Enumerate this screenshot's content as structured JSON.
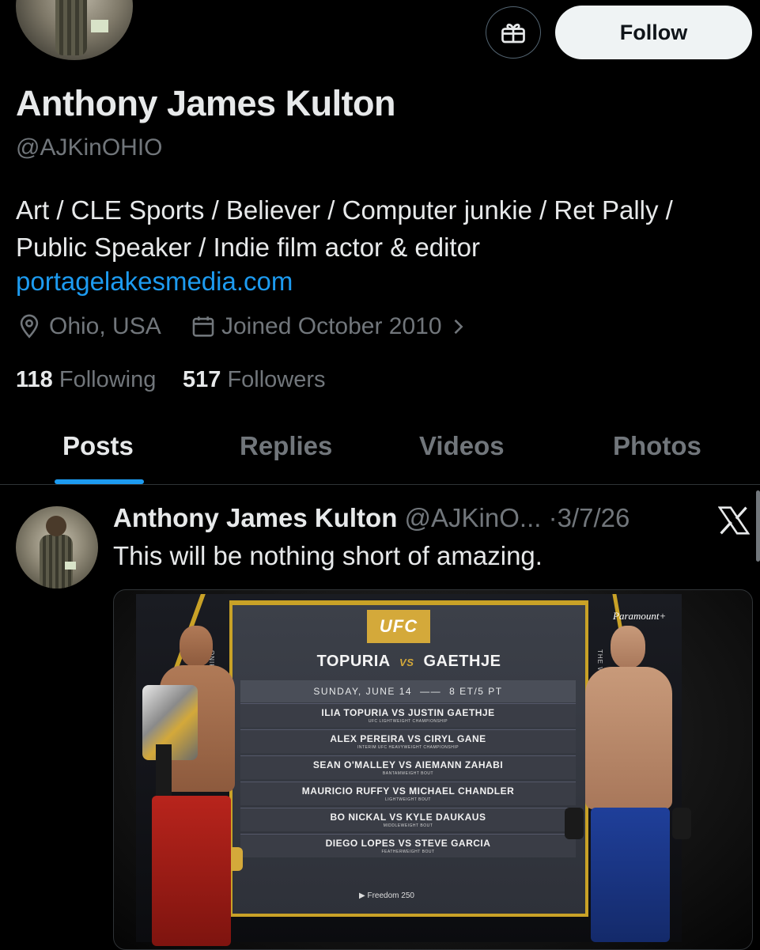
{
  "profile": {
    "name": "Anthony James Kulton",
    "handle": "@AJKinOHIO",
    "bio_line1": "Art / CLE Sports / Believer / Computer junkie / Ret Pally /",
    "bio_line2": "Public Speaker / Indie film actor & editor",
    "website": "portagelakesmedia.com",
    "location": "Ohio, USA",
    "joined": "Joined October 2010",
    "following_count": "118",
    "following_label": "Following",
    "followers_count": "517",
    "followers_label": "Followers",
    "follow_button": "Follow",
    "icons": [
      "gift-icon",
      "location-pin-icon",
      "calendar-icon",
      "chevron-right-icon"
    ]
  },
  "tabs": [
    {
      "label": "Posts",
      "active": true
    },
    {
      "label": "Replies",
      "active": false
    },
    {
      "label": "Videos",
      "active": false
    },
    {
      "label": "Photos",
      "active": false
    }
  ],
  "post": {
    "author": "Anthony James Kulton",
    "handle": "@AJKinO...",
    "separator": "·",
    "date": "3/7/26",
    "text": "This will be nothing short of amazing.",
    "source_icon": "x-logo-icon",
    "media": {
      "brand": "UFC",
      "title_left": "TOPURIA",
      "vs": "VS",
      "title_right": "GAETHJE",
      "date": "SUNDAY, JUNE 14",
      "time": "8 ET/5 PT",
      "side_left": "WASHING",
      "side_right": "THE WHITE HOUSE",
      "network": "Paramount+",
      "footer": "▶ Freedom 250",
      "bouts": [
        {
          "fighters": "ILIA TOPURIA VS JUSTIN GAETHJE",
          "division": "UFC LIGHTWEIGHT CHAMPIONSHIP"
        },
        {
          "fighters": "ALEX PEREIRA VS CIRYL GANE",
          "division": "INTERIM UFC HEAVYWEIGHT CHAMPIONSHIP"
        },
        {
          "fighters": "SEAN O'MALLEY VS AIEMANN ZAHABI",
          "division": "BANTAMWEIGHT BOUT"
        },
        {
          "fighters": "MAURICIO RUFFY VS MICHAEL CHANDLER",
          "division": "LIGHTWEIGHT BOUT"
        },
        {
          "fighters": "BO NICKAL VS KYLE DAUKAUS",
          "division": "MIDDLEWEIGHT BOUT"
        },
        {
          "fighters": "DIEGO LOPES VS STEVE GARCIA",
          "division": "FEATHERWEIGHT BOUT"
        }
      ]
    }
  },
  "colors": {
    "background": "#000000",
    "text_primary": "#e7e9ea",
    "text_muted": "#71767b",
    "accent": "#1d9bf0",
    "ufc_gold": "#c9a227"
  }
}
